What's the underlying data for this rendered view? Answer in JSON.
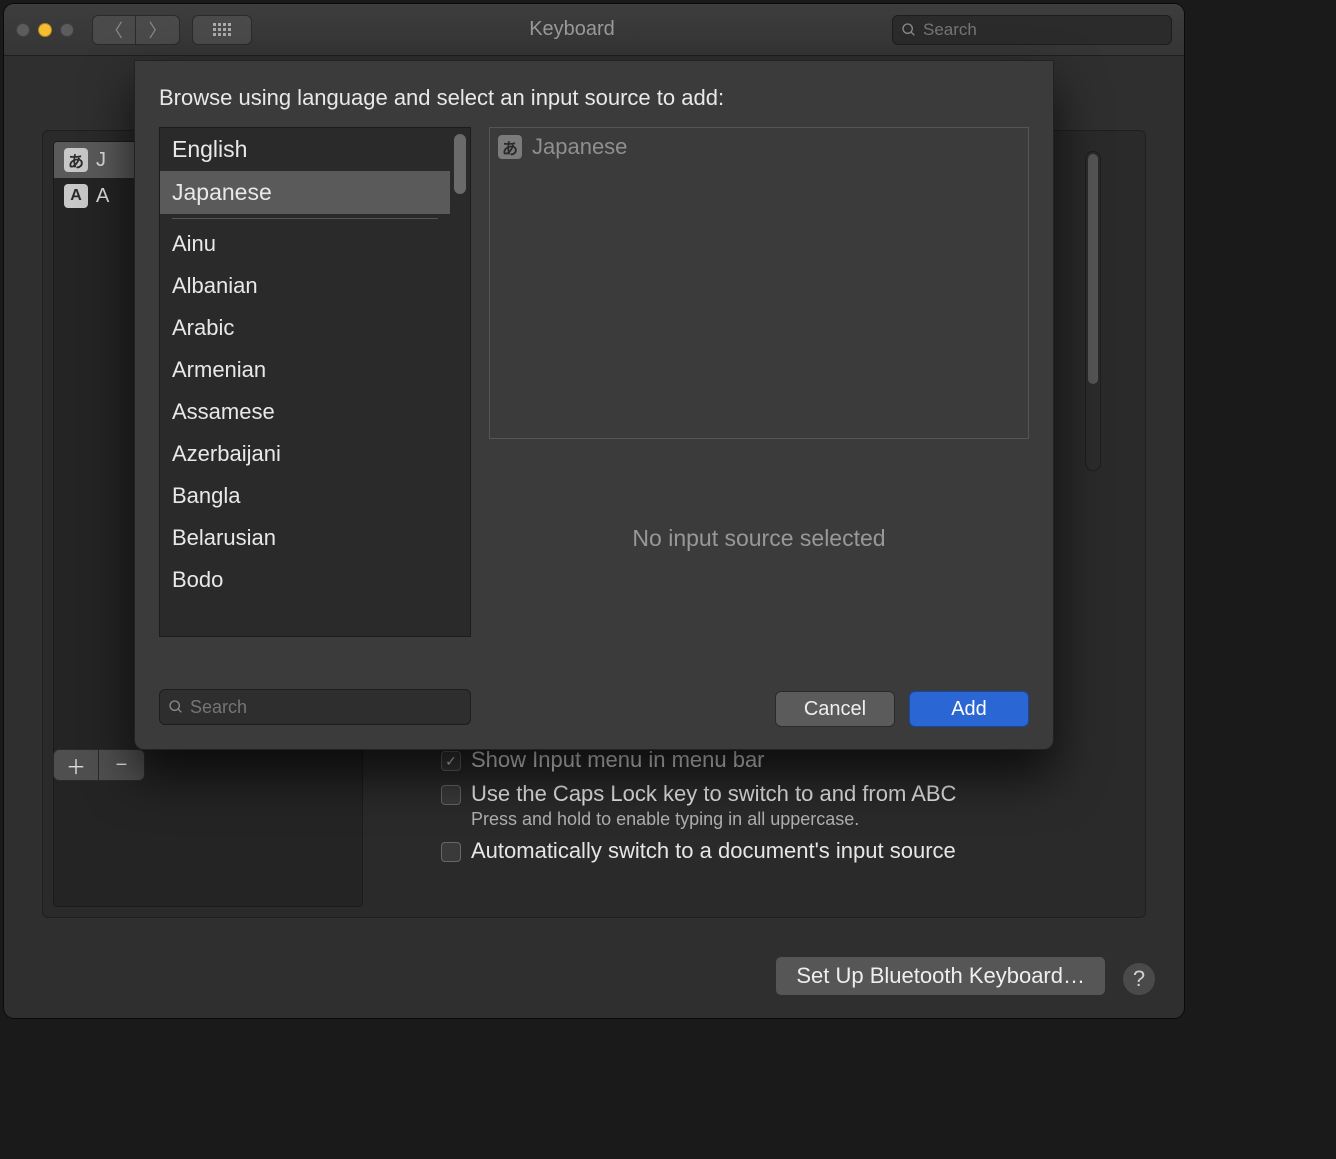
{
  "window": {
    "title": "Keyboard"
  },
  "toolbar": {
    "search_placeholder": "Search"
  },
  "sidebar": {
    "items": [
      {
        "icon": "あ",
        "label": "J"
      },
      {
        "icon": "A",
        "label": "A"
      }
    ]
  },
  "checks": {
    "show_input_menu": {
      "label": "Show Input menu in menu bar",
      "checked": true
    },
    "caps_lock": {
      "label": "Use the Caps Lock key to switch to and from ABC",
      "note": "Press and hold to enable typing in all uppercase.",
      "checked": false
    },
    "auto_switch": {
      "label": "Automatically switch to a document's input source",
      "checked": false
    }
  },
  "footer": {
    "bluetooth": "Set Up Bluetooth Keyboard…"
  },
  "sheet": {
    "title": "Browse using language and select an input source to add:",
    "languages_top": [
      "English",
      "Japanese"
    ],
    "languages": [
      "Ainu",
      "Albanian",
      "Arabic",
      "Armenian",
      "Assamese",
      "Azerbaijani",
      "Bangla",
      "Belarusian",
      "Bodo"
    ],
    "selected_language": "Japanese",
    "input_sources": [
      {
        "icon": "あ",
        "label": "Japanese"
      }
    ],
    "preview_text": "No input source selected",
    "search_placeholder": "Search",
    "cancel": "Cancel",
    "add": "Add"
  }
}
